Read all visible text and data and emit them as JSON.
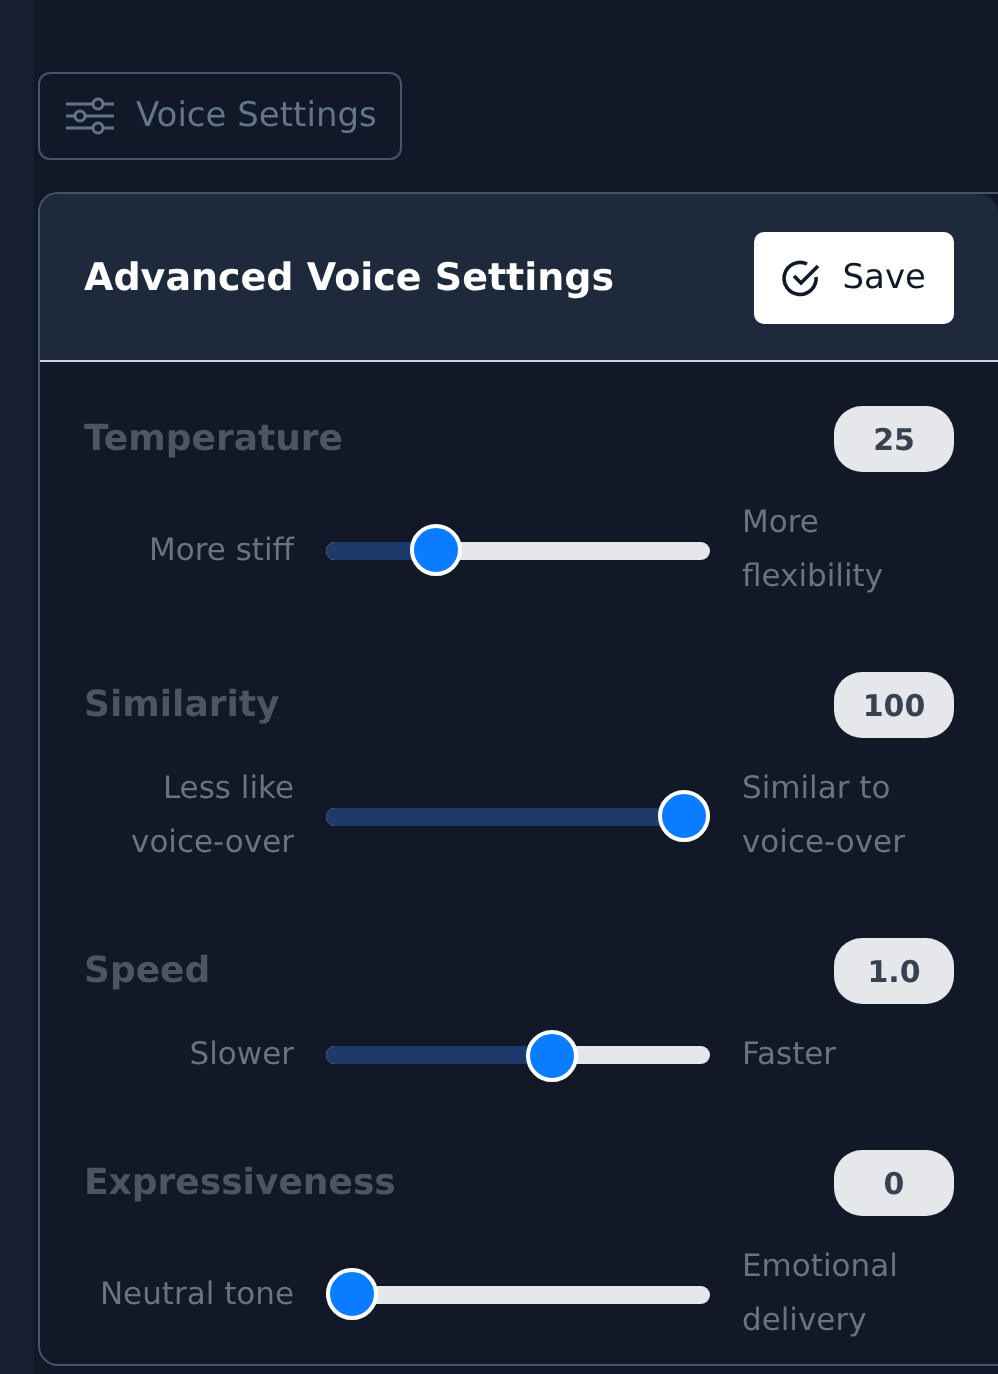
{
  "toggle_button": {
    "label": "Voice Settings"
  },
  "panel": {
    "title": "Advanced Voice Settings",
    "save_button": "Save"
  },
  "settings": [
    {
      "name": "Temperature",
      "value": "25",
      "level": 0.25,
      "min_label": "More stiff",
      "max_label": "More flexibility"
    },
    {
      "name": "Similarity",
      "value": "100",
      "level": 1.0,
      "min_label": "Less like voice-over",
      "max_label": "Similar to voice-over"
    },
    {
      "name": "Speed",
      "value": "1.0",
      "level": 0.6,
      "min_label": "Slower",
      "max_label": "Faster"
    },
    {
      "name": "Expressiveness",
      "value": "0",
      "level": 0.0,
      "min_label": "Neutral tone",
      "max_label": "Emotional delivery"
    }
  ]
}
